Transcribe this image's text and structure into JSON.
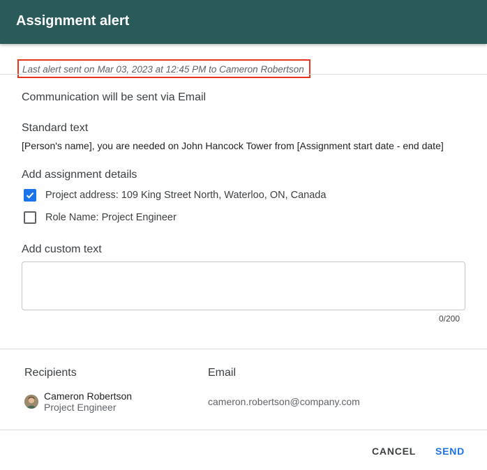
{
  "dialog": {
    "title": "Assignment alert",
    "last_alert": "Last alert sent on Mar 03, 2023 at 12:45 PM to Cameron Robertson"
  },
  "communication": {
    "text": "Communication will be sent via Email"
  },
  "standard_text": {
    "heading": "Standard text",
    "body": "[Person's name], you are needed on John Hancock Tower from [Assignment start date - end date]"
  },
  "assignment_details": {
    "heading": "Add assignment details",
    "options": [
      {
        "label": "Project address: 109 King Street North, Waterloo, ON, Canada",
        "checked": true
      },
      {
        "label": "Role Name: Project Engineer",
        "checked": false
      }
    ]
  },
  "custom_text": {
    "heading": "Add custom text",
    "value": "",
    "counter": "0/200"
  },
  "recipients": {
    "col_recipients": "Recipients",
    "col_email": "Email",
    "rows": [
      {
        "name": "Cameron Robertson",
        "role": "Project Engineer",
        "email": "cameron.robertson@company.com"
      }
    ]
  },
  "actions": {
    "cancel": "CANCEL",
    "send": "SEND"
  },
  "colors": {
    "header_bg": "#2b5a5a",
    "accent": "#1a73e8",
    "highlight_border": "#e8341c"
  }
}
